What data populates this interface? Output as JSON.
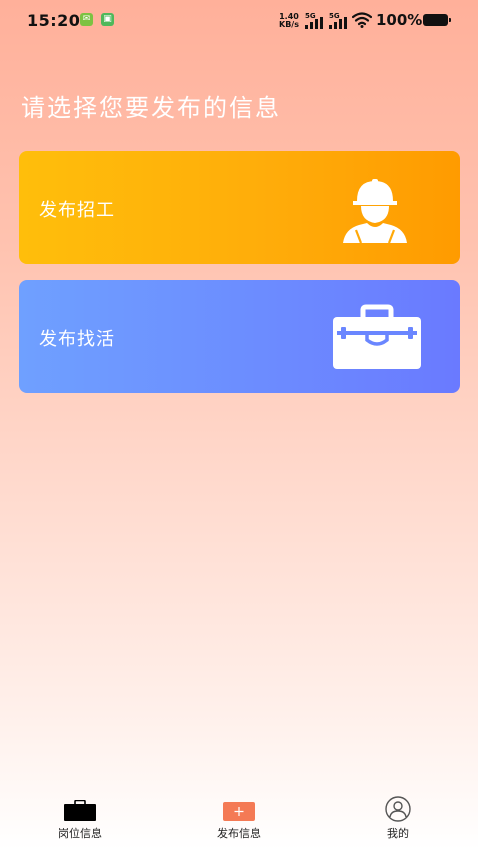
{
  "status_bar": {
    "time": "15:20",
    "net_speed_value": "1.40",
    "net_speed_unit": "KB/s",
    "signal_1_label": "5G",
    "signal_2_label": "5G",
    "battery": "100%"
  },
  "main": {
    "title": "请选择您要发布的信息",
    "cards": [
      {
        "label": "发布招工",
        "icon": "worker-icon",
        "color_start": "#FFBE0B",
        "color_end": "#FF9B00"
      },
      {
        "label": "发布找活",
        "icon": "toolbox-icon",
        "color_start": "#6FA0FF",
        "color_end": "#6A7AFF"
      }
    ]
  },
  "bottom_nav": {
    "items": [
      {
        "label": "岗位信息",
        "icon": "briefcase-icon"
      },
      {
        "label": "发布信息",
        "icon": "plus-icon",
        "accent": "#F47A55"
      },
      {
        "label": "我的",
        "icon": "user-icon"
      }
    ]
  }
}
